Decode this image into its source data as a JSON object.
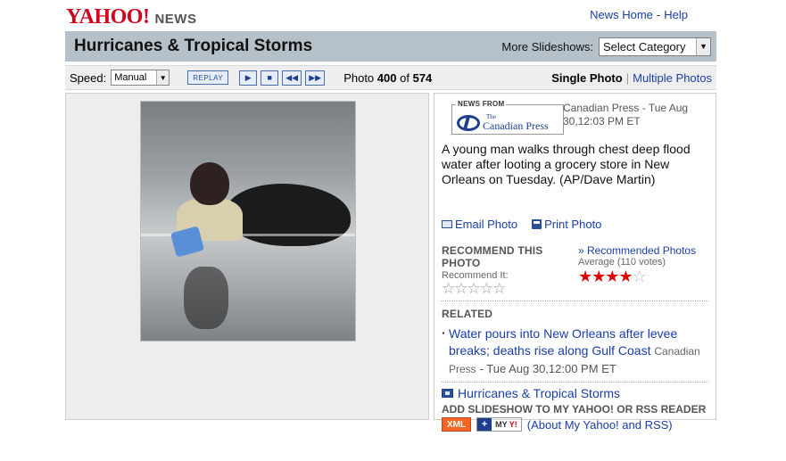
{
  "header": {
    "logo_text": "YAHOO!",
    "logo_section": "NEWS",
    "links": [
      "News Home",
      "Help"
    ],
    "link_separator": "-"
  },
  "titlebar": {
    "title": "Hurricanes & Tropical Storms",
    "more_label": "More Slideshows:",
    "category_select": "Select Category"
  },
  "controls": {
    "speed_label": "Speed:",
    "speed_value": "Manual",
    "replay_label": "REPLAY",
    "buttons": [
      "play-icon",
      "stop-icon",
      "previous-icon",
      "next-icon"
    ],
    "photo_prefix": "Photo",
    "photo_current": "400",
    "photo_of": "of",
    "photo_total": "574",
    "single_photo": "Single Photo",
    "multiple_photos": "Multiple Photos"
  },
  "photo": {
    "alt": "A young man walks through chest deep flood water"
  },
  "info": {
    "news_from": "NEWS FROM",
    "source_name": "Canadian Press",
    "source_name_small": "The",
    "meta": "Canadian Press - Tue Aug 30,12:03 PM ET",
    "caption": "A young man walks through chest deep flood water after looting a grocery store in New Orleans on Tuesday. (AP/Dave Martin)",
    "email_photo": "Email Photo",
    "print_photo": "Print Photo",
    "recommend_head": "RECOMMEND THIS PHOTO",
    "recommend_it": "Recommend It:",
    "recommended_link": "» Recommended Photos",
    "average": "Average (110 votes)",
    "rating": 4,
    "rating_max": 5,
    "related_head": "RELATED",
    "related_link": "Water pours into New Orleans after levee breaks; deaths rise along Gulf Coast",
    "related_source": "Canadian Press",
    "related_date": "- Tue Aug 30,12:00 PM ET",
    "slideshow_link": "Hurricanes & Tropical Storms",
    "add_head": "ADD SLIDESHOW TO MY YAHOO! OR RSS READER"
  },
  "badges": {
    "xml": "XML",
    "my_yahoo_plus": "+",
    "my_yahoo_my": "MY",
    "my_yahoo_y": "Y!",
    "about_link": "(About My Yahoo! and RSS)"
  },
  "colors": {
    "yahoo_red": "#d4001c",
    "link_blue": "#1a3ea8",
    "titlebar_bg": "#b6c0c9",
    "star_red": "#e00000",
    "xml_orange": "#f26522"
  }
}
